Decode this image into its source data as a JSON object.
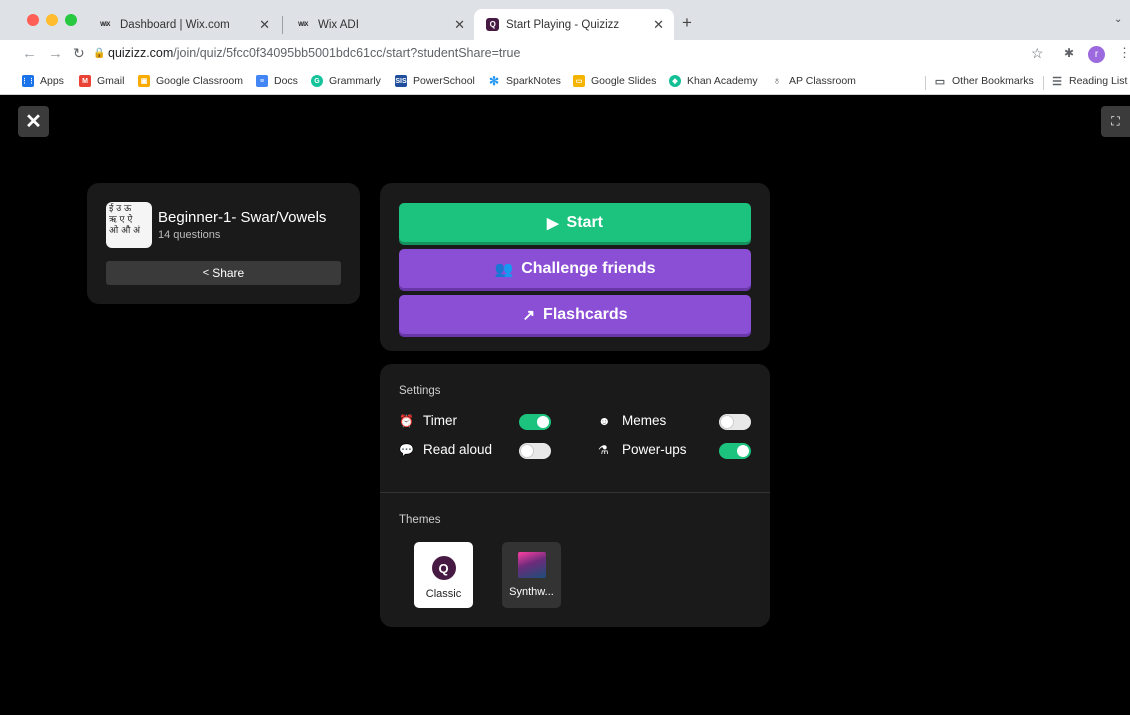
{
  "browser": {
    "tabs": [
      {
        "favicon": "WiX",
        "title": "Dashboard | Wix.com",
        "close": "✕"
      },
      {
        "favicon": "WiX",
        "title": "Wix ADI",
        "close": "✕"
      },
      {
        "favicon": "Q",
        "title": "Start Playing - Quizizz",
        "close": "✕"
      }
    ],
    "new_tab": "+",
    "url_host": "quizizz.com",
    "url_path": "/join/quiz/5fcc0f34095bb5001bdc61cc/start?studentShare=true",
    "bookmarks": [
      {
        "label": "Apps",
        "color": "#1a73e8"
      },
      {
        "label": "Gmail",
        "color": "#ea4335"
      },
      {
        "label": "Google Classroom",
        "color": "#f9ab00"
      },
      {
        "label": "Docs",
        "color": "#4285f4"
      },
      {
        "label": "Grammarly",
        "color": "#15c39a"
      },
      {
        "label": "PowerSchool",
        "color": "#1f4e9c"
      },
      {
        "label": "SparkNotes",
        "color": "#2196f3"
      },
      {
        "label": "Google Slides",
        "color": "#f4b400"
      },
      {
        "label": "Khan Academy",
        "color": "#14bf96"
      },
      {
        "label": "AP Classroom",
        "color": "#555555"
      },
      {
        "label": "Other Bookmarks",
        "color": "#5f6368"
      },
      {
        "label": "Reading List",
        "color": "#5f6368"
      }
    ],
    "profile_initial": "r"
  },
  "quiz": {
    "thumb_text": "ई उ ऊ\nऋ ए ऐ\nओ औ अं",
    "title": "Beginner-1- Swar/Vowels",
    "question_count": "14 questions",
    "share_label": "Share"
  },
  "actions": {
    "start_label": "Start",
    "challenge_label": "Challenge friends",
    "flashcards_label": "Flashcards"
  },
  "settings": {
    "heading": "Settings",
    "items": [
      {
        "label": "Timer",
        "icon": "alarm-icon",
        "on": true
      },
      {
        "label": "Memes",
        "icon": "laugh-icon",
        "on": false
      },
      {
        "label": "Read aloud",
        "icon": "speech-icon",
        "on": false
      },
      {
        "label": "Power-ups",
        "icon": "flask-icon",
        "on": true
      }
    ]
  },
  "themes": {
    "heading": "Themes",
    "items": [
      {
        "label": "Classic",
        "selected": true
      },
      {
        "label": "Synthw..."
      }
    ]
  },
  "colors": {
    "start": "#1cc37f",
    "purple": "#8b4fd6",
    "toggle_on": "#1cc37f"
  }
}
